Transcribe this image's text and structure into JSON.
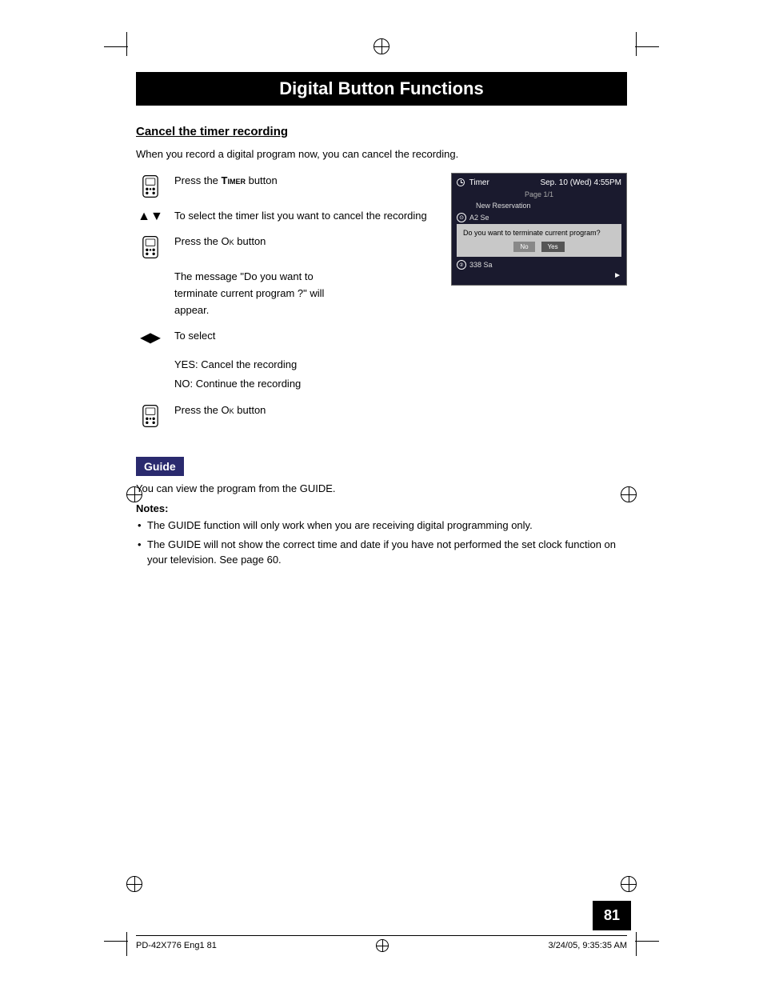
{
  "page": {
    "title": "Digital Button Functions",
    "number": "81"
  },
  "footer": {
    "left": "PD-42X776 Eng1  81",
    "right": "3/24/05, 9:35:35 AM"
  },
  "cancel_timer_section": {
    "heading": "Cancel the timer recording",
    "intro": "When you record a digital program now, you can cancel the recording.",
    "steps": [
      {
        "icon_type": "remote",
        "text": "Press the TIMER button"
      },
      {
        "icon_type": "updown_arrow",
        "text": "To select the timer list you want to cancel the recording"
      },
      {
        "icon_type": "remote",
        "text": "Press the OK button"
      },
      {
        "icon_type": "indent",
        "text": "The message \"Do you want to terminate current program ?\" will appear."
      },
      {
        "icon_type": "leftright_arrow",
        "text": "To select"
      },
      {
        "icon_type": "yes_no",
        "yes_label": "YES:",
        "yes_text": "Cancel the recording",
        "no_label": "NO:",
        "no_text": "Continue the recording"
      },
      {
        "icon_type": "remote",
        "text": "Press the OK button"
      }
    ]
  },
  "screen": {
    "header_label": "Timer",
    "header_date": "Sep. 10 (Wed)  4:55PM",
    "page_label": "Page 1/1",
    "new_reservation_label": "New Reservation",
    "rows": [
      {
        "icon": "clock",
        "col1": "A2",
        "col2": "Se"
      },
      {
        "icon": "number2",
        "col1": "338",
        "col2": "Sa"
      }
    ],
    "dialog": {
      "text": "Do you want to terminate current program?",
      "no_label": "No",
      "yes_label": "Yes"
    }
  },
  "guide_section": {
    "heading": "Guide",
    "text": "You can view the program from the GUIDE.",
    "notes_heading": "Notes:",
    "notes": [
      "The GUIDE function will only work when you are receiving digital programming only.",
      "The GUIDE will not show the correct time and date if you have not performed the set clock function on your television.  See page 60."
    ]
  }
}
